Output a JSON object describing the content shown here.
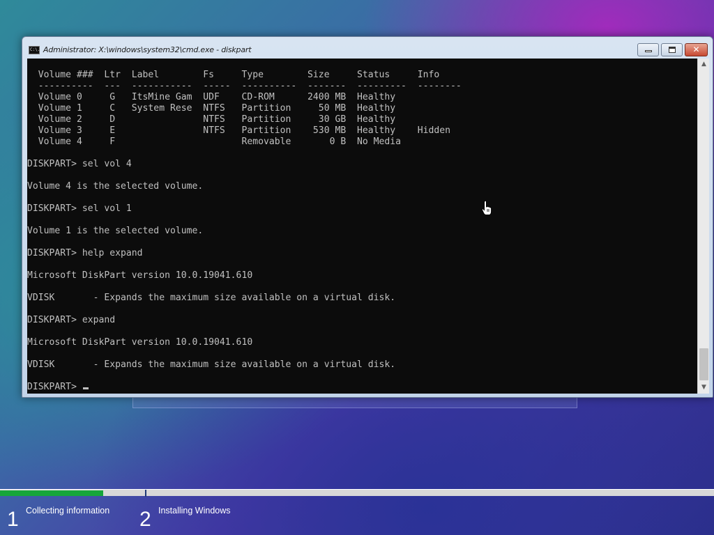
{
  "window": {
    "title": "Administrator: X:\\windows\\system32\\cmd.exe - diskpart",
    "icon_text": "C:\\."
  },
  "console": {
    "lines": [
      "  Volume ###  Ltr  Label        Fs     Type        Size     Status     Info",
      "  ----------  ---  -----------  -----  ----------  -------  ---------  --------",
      "  Volume 0     G   ItsMine Gam  UDF    CD-ROM      2400 MB  Healthy",
      "  Volume 1     C   System Rese  NTFS   Partition     50 MB  Healthy",
      "  Volume 2     D                NTFS   Partition     30 GB  Healthy",
      "  Volume 3     E                NTFS   Partition    530 MB  Healthy    Hidden",
      "  Volume 4     F                       Removable       0 B  No Media",
      "",
      "DISKPART> sel vol 4",
      "",
      "Volume 4 is the selected volume.",
      "",
      "DISKPART> sel vol 1",
      "",
      "Volume 1 is the selected volume.",
      "",
      "DISKPART> help expand",
      "",
      "Microsoft DiskPart version 10.0.19041.610",
      "",
      "VDISK       - Expands the maximum size available on a virtual disk.",
      "",
      "DISKPART> expand",
      "",
      "Microsoft DiskPart version 10.0.19041.610",
      "",
      "VDISK       - Expands the maximum size available on a virtual disk.",
      ""
    ],
    "prompt": "DISKPART> "
  },
  "setup_progress": {
    "fill_fraction": 0.145,
    "fill_color": "#16a63a",
    "steps": [
      {
        "number": "1",
        "label": "Collecting information"
      },
      {
        "number": "2",
        "label": "Installing Windows"
      }
    ]
  },
  "colors": {
    "console_bg": "#0c0c0c",
    "console_fg": "#c0c0c0"
  },
  "icons": {
    "window_icon": "cmd-icon",
    "minimize": "minimize-icon",
    "maximize": "maximize-icon",
    "close": "close-icon",
    "scroll_up": "chevron-up-icon",
    "scroll_down": "chevron-down-icon",
    "pointer": "hand-pointer-icon"
  }
}
